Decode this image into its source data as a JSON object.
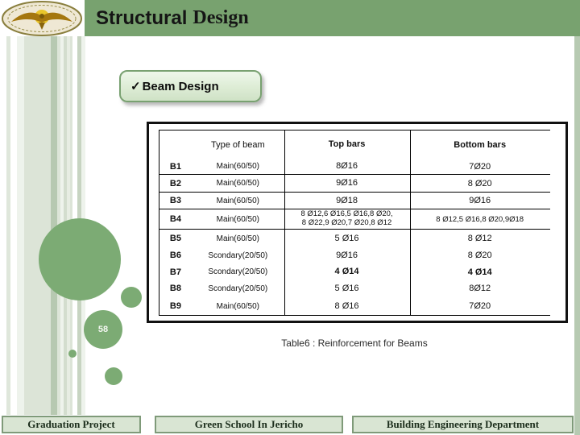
{
  "slide": {
    "title": {
      "main": "Structural",
      "accent": "Design"
    },
    "page_number": "58"
  },
  "badge": {
    "check": "✓",
    "label": "Beam Design"
  },
  "table": {
    "caption": "Table6 : Reinforcement for Beams",
    "headers": {
      "type": "Type of beam",
      "top": "Top bars",
      "bottom": "Bottom bars"
    },
    "rows": [
      {
        "id": "B1",
        "type": "Main(60/50)",
        "top": "8Ø16",
        "bottom": "7Ø20"
      },
      {
        "id": "B2",
        "type": "Main(60/50)",
        "top": "9Ø16",
        "bottom": "8 Ø20"
      },
      {
        "id": "B3",
        "type": "Main(60/50)",
        "top": "9Ø18",
        "bottom": "9Ø16"
      },
      {
        "id": "B4",
        "type": "Main(60/50)",
        "top": "8 Ø12,6 Ø16,5 Ø16,8 Ø20,\n8 Ø22,9 Ø20,7 Ø20,8 Ø12",
        "bottom": "8 Ø12,5 Ø16,8 Ø20,9Ø18"
      },
      {
        "id": "B5",
        "type": "Main(60/50)",
        "top": "5 Ø16",
        "bottom": "8 Ø12"
      },
      {
        "id": "B6",
        "type": "Scondary(20/50)",
        "top": "9Ø16",
        "bottom": "8 Ø20"
      },
      {
        "id": "B7",
        "type": "Scondary(20/50)",
        "top": "4 Ø14",
        "bottom": "4 Ø14"
      },
      {
        "id": "B8",
        "type": "Scondary(20/50)",
        "top": "5 Ø16",
        "bottom": "8Ø12"
      },
      {
        "id": "B9",
        "type": "Main(60/50)",
        "top": "8 Ø16",
        "bottom": "7Ø20"
      }
    ]
  },
  "footer": {
    "left": "Graduation Project",
    "center": "Green School In Jericho",
    "right": "Building Engineering Department"
  },
  "colors": {
    "header_green": "#78a26f",
    "circle_green": "#7cab74",
    "stripe_accent": "#b7c9b1",
    "footer_fill": "#d9e5d3",
    "footer_border": "#7f9a79",
    "badge_border": "#79a171"
  },
  "logo": {
    "name": "university-emblem"
  }
}
